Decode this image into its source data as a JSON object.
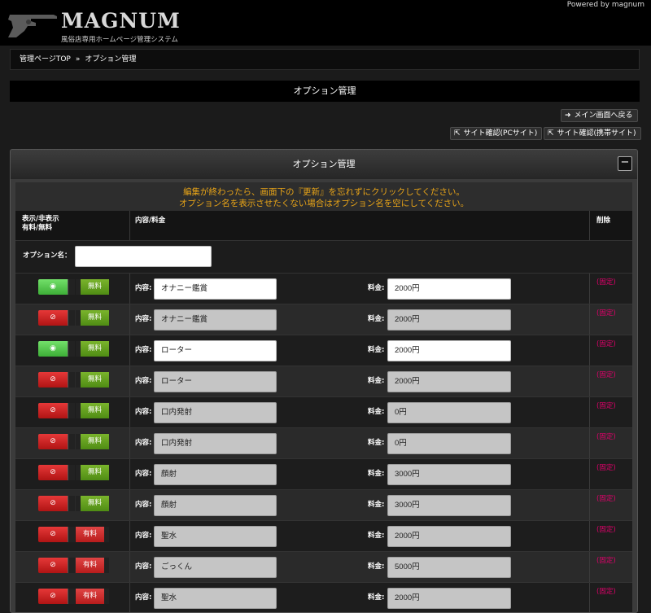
{
  "header": {
    "logo_title": "MAGNUM",
    "logo_subtitle": "風俗店専用ホームページ管理システム",
    "powered_by": "Powered by magnum"
  },
  "breadcrumb": {
    "home": "管理ページTOP",
    "separator": "»",
    "current": "オプション管理"
  },
  "page_title": "オプション管理",
  "actions": {
    "back_main": "メイン画面へ戻る",
    "site_pc": "サイト確認(PCサイト)",
    "site_mobile": "サイト確認(携帯サイト)"
  },
  "panel": {
    "title": "オプション管理",
    "collapse_symbol": "−",
    "notice_line1": "編集が終わったら、画面下の『更新』を忘れずにクリックしてください。",
    "notice_line2": "オプション名を表示させたくない場合はオプション名を空にしてください。"
  },
  "table": {
    "col_toggle_line1": "表示/非表示",
    "col_toggle_line2": "有料/無料",
    "col_content_price": "内容/料金",
    "col_delete": "削除",
    "option_name_label": "オプション名：",
    "option_name_value": "",
    "content_label": "内容:",
    "price_label": "料金:",
    "fixed_label": "(固定)",
    "free_label": "無料",
    "paid_label": "有料",
    "rows": [
      {
        "visible": true,
        "paid": false,
        "content": "オナニー鑑賞",
        "price": "2000円",
        "editable": true
      },
      {
        "visible": false,
        "paid": false,
        "content": "オナニー鑑賞",
        "price": "2000円",
        "editable": false
      },
      {
        "visible": true,
        "paid": false,
        "content": "ローター",
        "price": "2000円",
        "editable": true
      },
      {
        "visible": false,
        "paid": false,
        "content": "ローター",
        "price": "2000円",
        "editable": false
      },
      {
        "visible": false,
        "paid": false,
        "content": "口内発射",
        "price": "0円",
        "editable": false
      },
      {
        "visible": false,
        "paid": false,
        "content": "口内発射",
        "price": "0円",
        "editable": false
      },
      {
        "visible": false,
        "paid": false,
        "content": "顔射",
        "price": "3000円",
        "editable": false
      },
      {
        "visible": false,
        "paid": false,
        "content": "顔射",
        "price": "3000円",
        "editable": false
      },
      {
        "visible": false,
        "paid": true,
        "content": "聖水",
        "price": "2000円",
        "editable": false
      },
      {
        "visible": false,
        "paid": true,
        "content": "ごっくん",
        "price": "5000円",
        "editable": false
      },
      {
        "visible": false,
        "paid": true,
        "content": "聖水",
        "price": "2000円",
        "editable": false
      }
    ]
  }
}
